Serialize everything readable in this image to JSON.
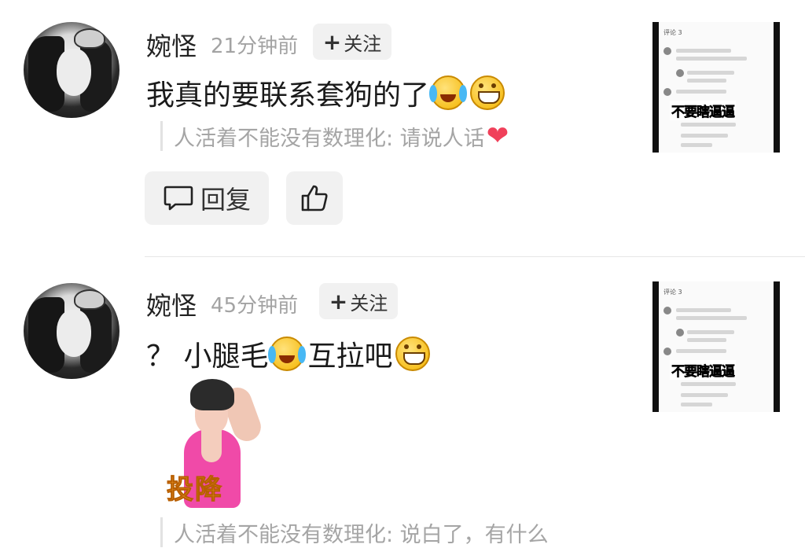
{
  "comments": [
    {
      "username": "婉怪",
      "time": "21分钟前",
      "follow_label": "关注",
      "text": "我真的要联系套狗的了",
      "emojis": [
        "cry-laugh-emoji",
        "grin-emoji"
      ],
      "quote": "人活着不能没有数理化: 请说人话",
      "quote_emoji": "heart",
      "reply_label": "回复",
      "thumb": {
        "title": "评论 3",
        "caption": "不要瞎逼逼"
      }
    },
    {
      "username": "婉怪",
      "time": "45分钟前",
      "follow_label": "关注",
      "text_part1": "？ 小腿毛",
      "text_part2": "互拉吧",
      "emojis": [
        "cry-laugh-emoji",
        "grin-emoji"
      ],
      "sticker_text": "投降",
      "quote": "人活着不能没有数理化: 说白了，有什么",
      "thumb": {
        "title": "评论 3",
        "caption": "不要瞎逼逼"
      }
    }
  ],
  "colors": {
    "username": "#222222",
    "meta": "#a3a3a3",
    "button_bg": "#f1f1f1",
    "heart": "#f0405a"
  }
}
